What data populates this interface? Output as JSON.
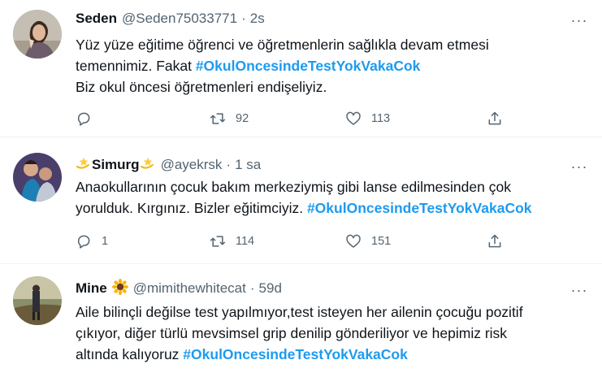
{
  "tweets": [
    {
      "name": "Seden",
      "handle": "@Seden75033771",
      "dot": "·",
      "time": "2s",
      "more": "···",
      "text_line1": "Yüz yüze eğitime öğrenci ve öğretmenlerin sağlıkla devam etmesi",
      "text_line2_prefix": "temennimiz. Fakat ",
      "hashtag": "#OkulOncesindeTestYokVakaCok",
      "text_line3": "Biz okul öncesi öğretmenleri endişeliyiz.",
      "replies": "",
      "retweets": "92",
      "likes": "113"
    },
    {
      "name": "Simurg",
      "handle": "@ayekrsk",
      "dot": "·",
      "time": "1 sa",
      "more": "···",
      "text_line1": "Anaokullarının çocuk bakım merkeziymiş gibi lanse edilmesinden çok",
      "text_line2_prefix": "yorulduk. Kırgınız. Bizler eğitimciyiz. ",
      "hashtag": "#OkulOncesindeTestYokVakaCok",
      "replies": "1",
      "retweets": "114",
      "likes": "151"
    },
    {
      "name": "Mine",
      "handle": "@mimithewhitecat",
      "dot": "·",
      "time": "59d",
      "more": "···",
      "text_line1": "Aile bilinçli değilse test yapılmıyor,test isteyen her ailenin çocuğu pozitif",
      "text_line2": "çıkıyor, diğer türlü mevsimsel grip denilip gönderiliyor ve hepimiz risk",
      "text_line3_prefix": "altında kalıyoruz ",
      "hashtag": "#OkulOncesindeTestYokVakaCok"
    }
  ],
  "icons": {
    "reply": "reply-icon",
    "retweet": "retweet-icon",
    "like": "heart-icon",
    "share": "share-icon",
    "more": "more-icon"
  },
  "colors": {
    "hashtag": "#1d9bf0",
    "secondary_text": "#536471",
    "divider": "#eff3f4",
    "primary_text": "#0f1419"
  }
}
